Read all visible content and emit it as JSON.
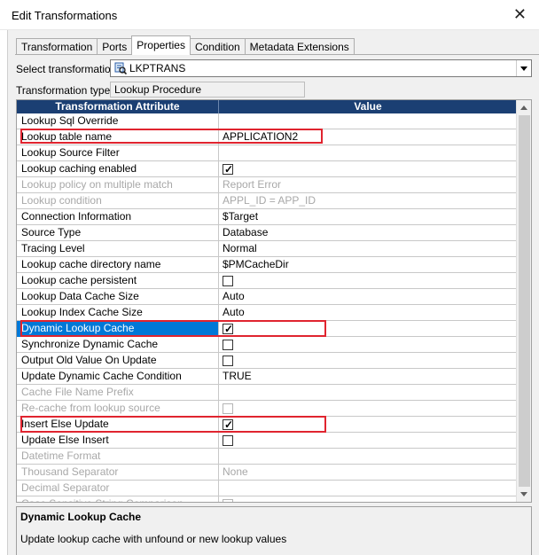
{
  "window": {
    "title": "Edit Transformations",
    "close_glyph": "✕"
  },
  "tabs": [
    {
      "label": "Transformation",
      "active": false
    },
    {
      "label": "Ports",
      "active": false
    },
    {
      "label": "Properties",
      "active": true
    },
    {
      "label": "Condition",
      "active": false
    },
    {
      "label": "Metadata Extensions",
      "active": false
    }
  ],
  "select_transformation": {
    "label": "Select transformation:",
    "value": "LKPTRANS",
    "icon": "lookup-transformation-icon"
  },
  "transformation_type": {
    "label": "Transformation type:",
    "value": "Lookup Procedure"
  },
  "grid": {
    "headers": {
      "attribute": "Transformation Attribute",
      "value": "Value"
    },
    "rows": [
      {
        "attr": "Lookup Sql Override",
        "value": "",
        "disabled": false
      },
      {
        "attr": "Lookup table name",
        "value": "APPLICATION2",
        "disabled": false,
        "highlight": true
      },
      {
        "attr": "Lookup Source Filter",
        "value": "",
        "disabled": false
      },
      {
        "attr": "Lookup caching enabled",
        "checkbox": true,
        "checked": true,
        "disabled": false
      },
      {
        "attr": "Lookup policy on multiple match",
        "value": "Report Error",
        "disabled": true
      },
      {
        "attr": "Lookup condition",
        "value": "APPL_ID = APP_ID",
        "disabled": true
      },
      {
        "attr": "Connection Information",
        "value": "$Target",
        "disabled": false
      },
      {
        "attr": "Source Type",
        "value": "Database",
        "disabled": false
      },
      {
        "attr": "Tracing Level",
        "value": "Normal",
        "disabled": false
      },
      {
        "attr": "Lookup cache directory name",
        "value": "$PMCacheDir",
        "disabled": false
      },
      {
        "attr": "Lookup cache persistent",
        "checkbox": true,
        "checked": false,
        "disabled": false
      },
      {
        "attr": "Lookup Data Cache Size",
        "value": "Auto",
        "disabled": false
      },
      {
        "attr": "Lookup Index Cache Size",
        "value": "Auto",
        "disabled": false
      },
      {
        "attr": "Dynamic Lookup Cache",
        "checkbox": true,
        "checked": true,
        "disabled": false,
        "selected": true,
        "highlight": true
      },
      {
        "attr": "Synchronize Dynamic Cache",
        "checkbox": true,
        "checked": false,
        "disabled": false
      },
      {
        "attr": "Output Old Value On Update",
        "checkbox": true,
        "checked": false,
        "disabled": false
      },
      {
        "attr": "Update Dynamic Cache Condition",
        "value": "TRUE",
        "disabled": false
      },
      {
        "attr": "Cache File Name Prefix",
        "value": "",
        "disabled": true
      },
      {
        "attr": "Re-cache from lookup source",
        "checkbox": true,
        "checked": false,
        "disabled": true
      },
      {
        "attr": "Insert Else Update",
        "checkbox": true,
        "checked": true,
        "disabled": false,
        "highlight": true
      },
      {
        "attr": "Update Else Insert",
        "checkbox": true,
        "checked": false,
        "disabled": false
      },
      {
        "attr": "Datetime Format",
        "value": "",
        "disabled": true
      },
      {
        "attr": "Thousand Separator",
        "value": "None",
        "disabled": true
      },
      {
        "attr": "Decimal Separator",
        "value": "",
        "disabled": true
      },
      {
        "attr": "Case Sensitive String Comparison",
        "checkbox": true,
        "checked": false,
        "disabled": true
      }
    ]
  },
  "description": {
    "title": "Dynamic Lookup Cache",
    "text": "Update lookup cache with unfound or new lookup values"
  },
  "colors": {
    "header_bg": "#1b3f73",
    "selected_bg": "#0078d7",
    "highlight_border": "#e0242f"
  }
}
